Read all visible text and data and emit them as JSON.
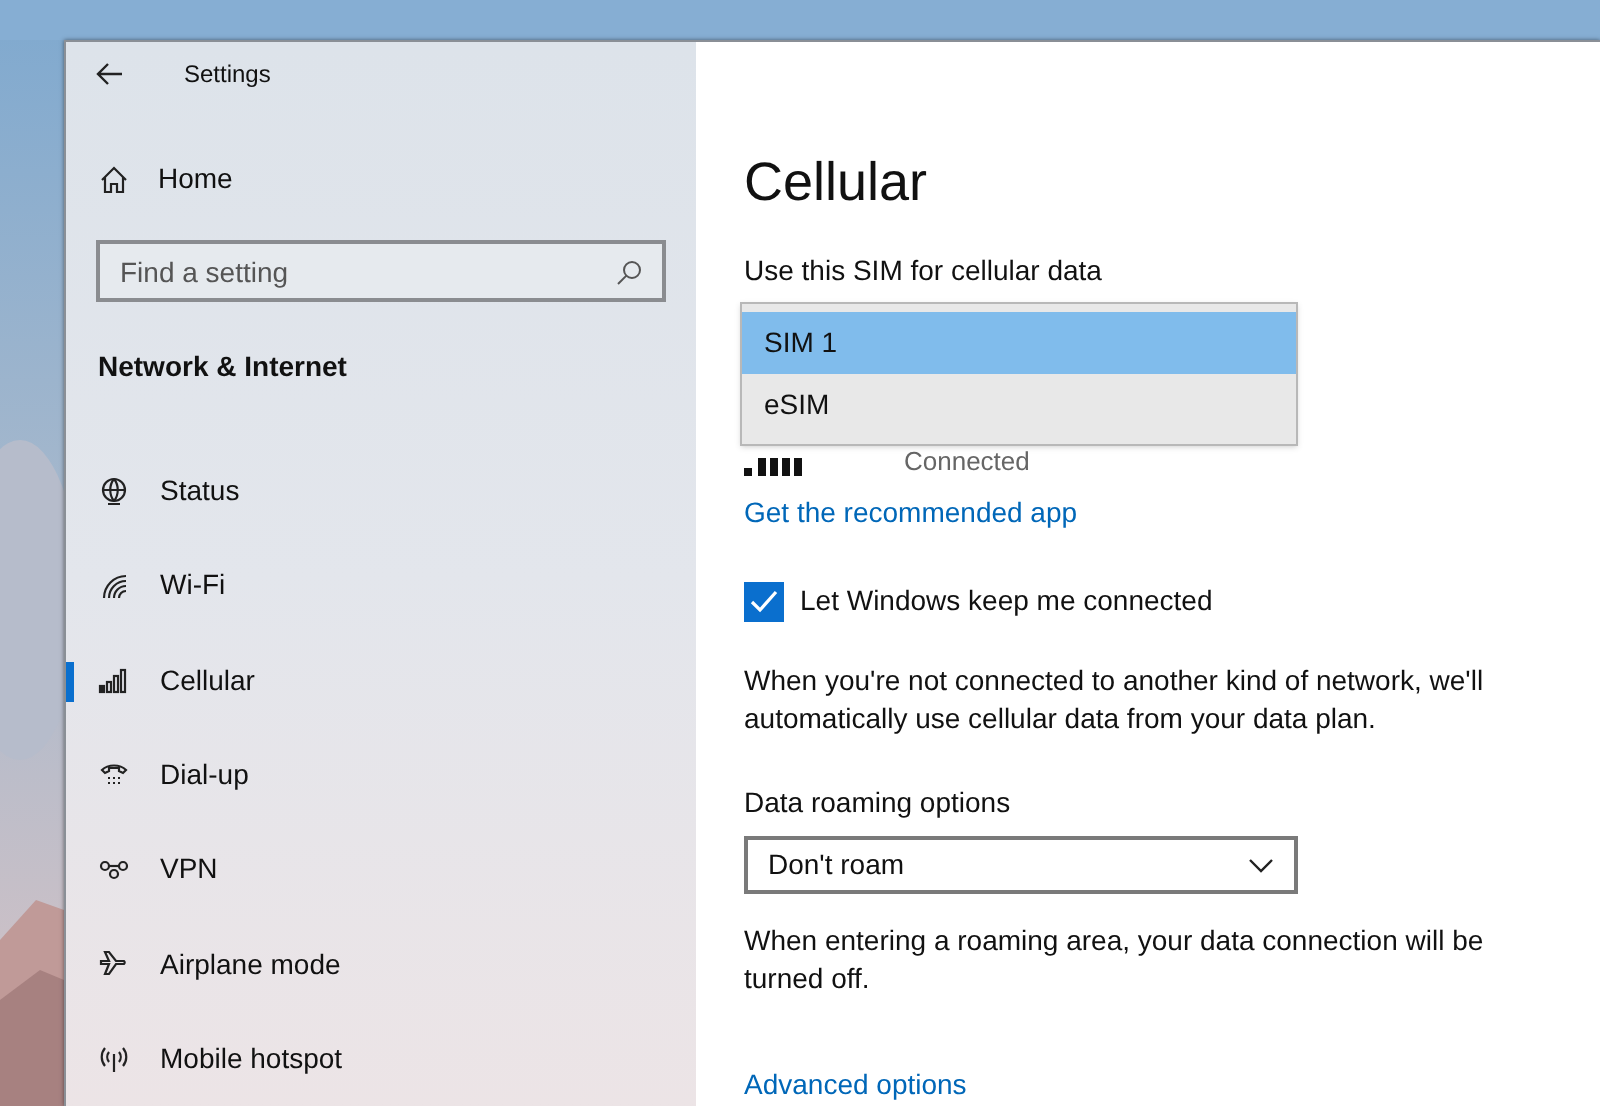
{
  "window": {
    "title": "Settings"
  },
  "sidebar": {
    "home": "Home",
    "search": {
      "placeholder": "Find a setting"
    },
    "section": "Network & Internet",
    "items": [
      {
        "label": "Status",
        "kind": "globe",
        "selected": false
      },
      {
        "label": "Wi-Fi",
        "kind": "wifi",
        "selected": false
      },
      {
        "label": "Cellular",
        "kind": "cellular",
        "selected": true
      },
      {
        "label": "Dial-up",
        "kind": "dialup",
        "selected": false
      },
      {
        "label": "VPN",
        "kind": "vpn",
        "selected": false
      },
      {
        "label": "Airplane mode",
        "kind": "airplane",
        "selected": false
      },
      {
        "label": "Mobile hotspot",
        "kind": "hotspot",
        "selected": false
      }
    ]
  },
  "main": {
    "title": "Cellular",
    "sim_label": "Use this SIM for cellular data",
    "sim_options": [
      {
        "label": "SIM 1",
        "selected": true
      },
      {
        "label": "eSIM",
        "selected": false
      }
    ],
    "connection_status": "Connected",
    "app_link": "Get the recommended app",
    "keep_connected": {
      "label": "Let Windows keep me connected",
      "checked": true
    },
    "description": "When you're not connected to another kind of network, we'll automatically use cellular data from your data plan.",
    "roaming_label": "Data roaming options",
    "roaming_value": "Don't roam",
    "roaming_note": "When entering a roaming area, your data connection will be turned off.",
    "advanced_link": "Advanced options"
  }
}
